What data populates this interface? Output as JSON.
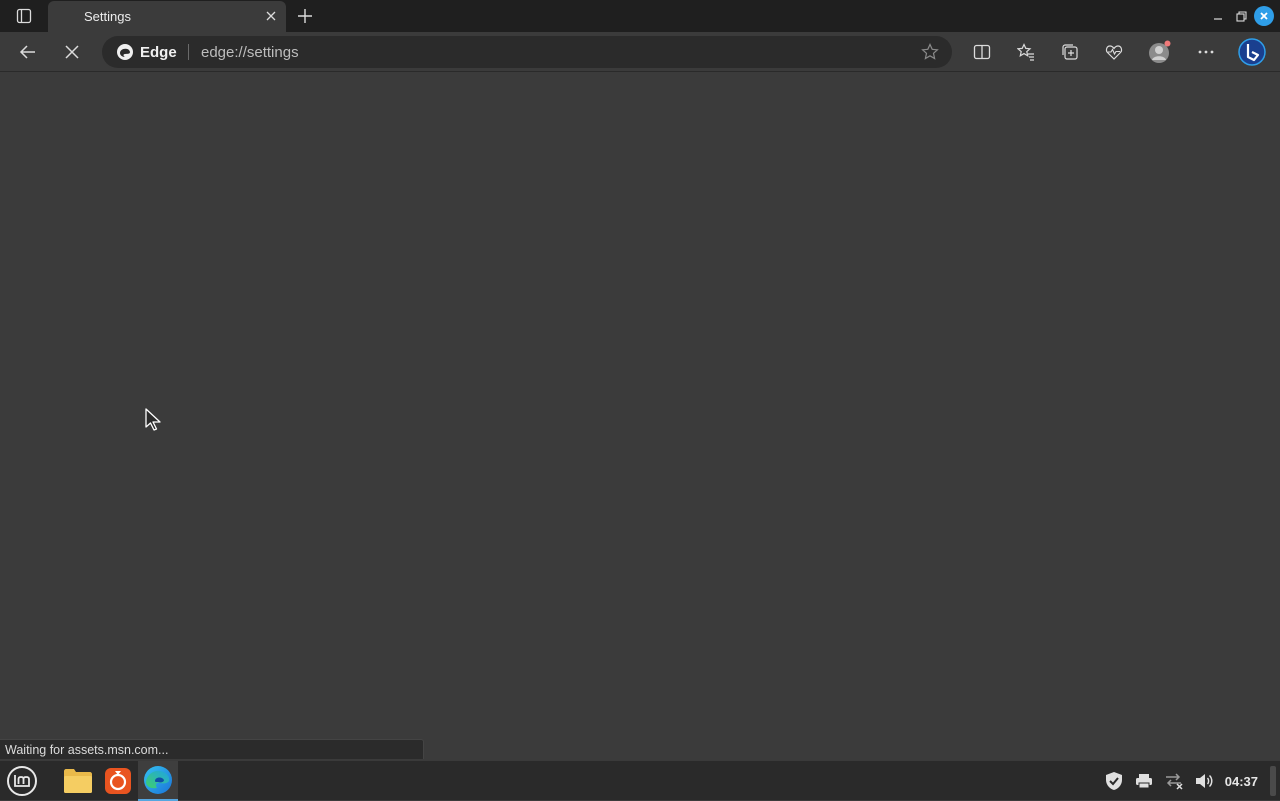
{
  "browser": {
    "tab": {
      "title": "Settings"
    },
    "addressbar": {
      "badge": "Edge",
      "url": "edge://settings"
    },
    "status": "Waiting for assets.msn.com..."
  },
  "icons": {
    "tab_actions": "tab-actions-icon",
    "tab_close": "close-icon",
    "new_tab": "plus-icon",
    "minimize": "minimize-icon",
    "restore": "restore-icon",
    "window_close": "close-icon",
    "back": "arrow-left-icon",
    "stop": "stop-icon",
    "favorite": "star-icon",
    "split": "split-screen-icon",
    "favorites": "favorites-icon",
    "collections": "collections-icon",
    "performance": "heartbeat-icon",
    "profile": "avatar-icon",
    "more": "ellipsis-icon",
    "copilot": "bing-icon"
  },
  "taskbar": {
    "apps": [
      "mint-menu",
      "files",
      "ubuntu-software",
      "edge"
    ],
    "clock": "04:37"
  },
  "colors": {
    "accent": "#2f9ee8",
    "page_bg": "#3b3b3b",
    "tabstrip_bg": "#1f1f1f"
  }
}
